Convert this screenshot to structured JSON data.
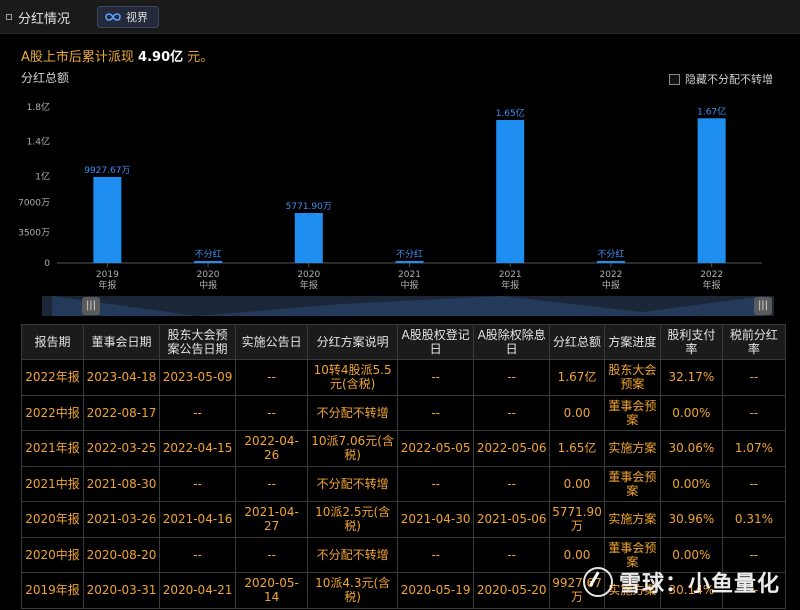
{
  "tabs": {
    "main_label": "分红情况",
    "view_label": "视界"
  },
  "summary": {
    "prefix": "A股上市后累计派现",
    "amount": "4.90亿",
    "suffix": "元。"
  },
  "chart_section": {
    "title": "分红总额",
    "toggle_label": "隐藏不分配不转增",
    "toggle_checked": false
  },
  "chart_data": {
    "type": "bar",
    "title": "",
    "xlabel": "",
    "ylabel": "",
    "ylim": [
      0,
      180000000
    ],
    "y_ticks": [
      {
        "value": 0,
        "label": "0"
      },
      {
        "value": 35000000,
        "label": "3500万"
      },
      {
        "value": 70000000,
        "label": "7000万"
      },
      {
        "value": 100000000,
        "label": "1亿"
      },
      {
        "value": 140000000,
        "label": "1.4亿"
      },
      {
        "value": 180000000,
        "label": "1.8亿"
      }
    ],
    "categories": [
      {
        "year": "2019",
        "period": "年报"
      },
      {
        "year": "2020",
        "period": "中报"
      },
      {
        "year": "2020",
        "period": "年报"
      },
      {
        "year": "2021",
        "period": "中报"
      },
      {
        "year": "2021",
        "period": "年报"
      },
      {
        "year": "2022",
        "period": "中报"
      },
      {
        "year": "2022",
        "period": "年报"
      }
    ],
    "values": [
      99276700,
      0,
      57719000,
      0,
      165000000,
      0,
      167000000
    ],
    "labels": [
      "9927.67万",
      "不分红",
      "5771.90万",
      "不分红",
      "1.65亿",
      "不分红",
      "1.67亿"
    ],
    "bar_color": "#1f8ef1",
    "grid": false
  },
  "table": {
    "headers": [
      "报告期",
      "董事会日期",
      "股东大会预案公告日期",
      "实施公告日",
      "分红方案说明",
      "A股股权登记日",
      "A股除权除息日",
      "分红总额",
      "方案进度",
      "股利支付率",
      "税前分红率"
    ],
    "rows": [
      [
        "2022年报",
        "2023-04-18",
        "2023-05-09",
        "--",
        "10转4股派5.5元(含税)",
        "--",
        "--",
        "1.67亿",
        "股东大会预案",
        "32.17%",
        "--"
      ],
      [
        "2022中报",
        "2022-08-17",
        "--",
        "--",
        "不分配不转增",
        "--",
        "--",
        "0.00",
        "董事会预案",
        "0.00%",
        "--"
      ],
      [
        "2021年报",
        "2022-03-25",
        "2022-04-15",
        "2022-04-26",
        "10派7.06元(含税)",
        "2022-05-05",
        "2022-05-06",
        "1.65亿",
        "实施方案",
        "30.06%",
        "1.07%"
      ],
      [
        "2021中报",
        "2021-08-30",
        "--",
        "--",
        "不分配不转增",
        "--",
        "--",
        "0.00",
        "董事会预案",
        "0.00%",
        "--"
      ],
      [
        "2020年报",
        "2021-03-26",
        "2021-04-16",
        "2021-04-27",
        "10派2.5元(含税)",
        "2021-04-30",
        "2021-05-06",
        "5771.90万",
        "实施方案",
        "30.96%",
        "0.31%"
      ],
      [
        "2020中报",
        "2020-08-20",
        "--",
        "--",
        "不分配不转增",
        "--",
        "--",
        "0.00",
        "董事会预案",
        "0.00%",
        "--"
      ],
      [
        "2019年报",
        "2020-03-31",
        "2020-04-21",
        "2020-05-14",
        "10派4.3元(含税)",
        "2020-05-19",
        "2020-05-20",
        "9927.67万",
        "实施方案",
        "30.14%",
        "--"
      ]
    ]
  },
  "watermark": {
    "text": "雪球：小鱼量化"
  },
  "colors": {
    "accent_orange": "#f0a432",
    "bar_blue": "#1f8ef1",
    "background": "#000000"
  }
}
